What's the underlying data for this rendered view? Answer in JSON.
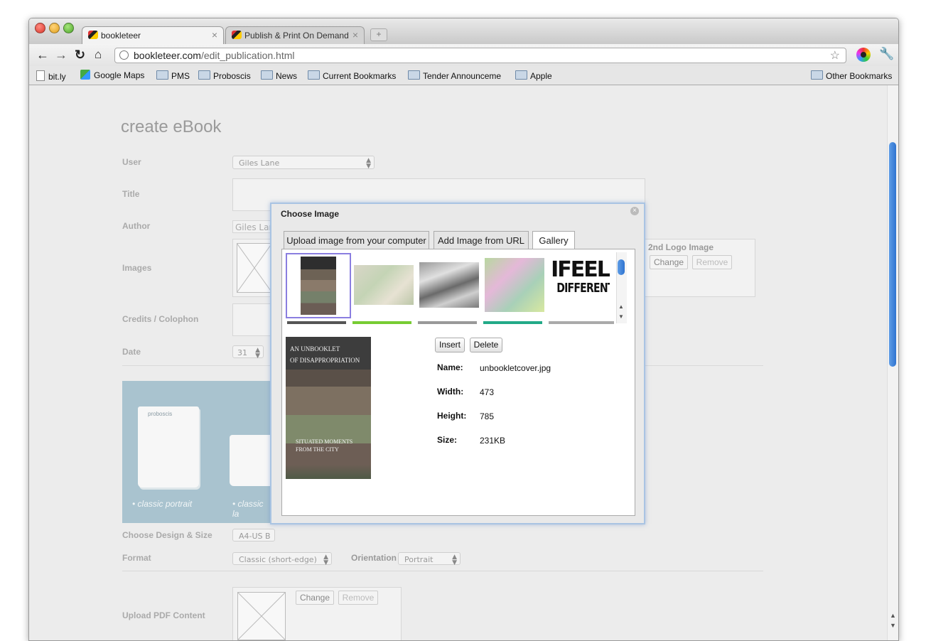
{
  "browser": {
    "tabs": [
      {
        "label": "bookleteer",
        "close": "×"
      },
      {
        "label": "Publish & Print On Demand",
        "close": "×"
      }
    ],
    "new_tab": "+",
    "url_host": "bookleteer.com",
    "url_path": "/edit_publication.html",
    "bookmarks": [
      "bit.ly",
      "Google Maps",
      "PMS",
      "Proboscis",
      "News",
      "Current Bookmarks",
      "Tender Announceme",
      "Apple"
    ],
    "other_bookmarks": "Other Bookmarks"
  },
  "form": {
    "heading": "create eBook",
    "user_label": "User",
    "user_value": "Giles Lane",
    "title_label": "Title",
    "author_label": "Author",
    "author_value": "Giles Lane",
    "images_label": "Images",
    "logo2_label": "2nd Logo Image",
    "change": "Change",
    "remove": "Remove",
    "credits_label": "Credits / Colophon",
    "date_label": "Date",
    "date_day": "31",
    "design_cards": [
      {
        "brand": "proboscis",
        "caption": "• classic portrait"
      },
      {
        "caption": "• classic la"
      }
    ],
    "design_label": "Choose Design & Size",
    "design_value": "A4-US B",
    "format_label": "Format",
    "format_value": "Classic (short-edge)",
    "orientation_label": "Orientation",
    "orientation_value": "Portrait",
    "pdf_label": "Upload PDF Content"
  },
  "modal": {
    "title": "Choose Image",
    "close": "×",
    "tabs": [
      "Upload image from your computer",
      "Add Image from URL",
      "Gallery"
    ],
    "gallery_text_thumb": [
      "IFEEL",
      "DIFFERENT"
    ],
    "insert": "Insert",
    "delete": "Delete",
    "preview_title": [
      "AN UNBOOKLET",
      "OF DISAPPROPRIATION"
    ],
    "preview_subtitle": [
      "SITUATED MOMENTS",
      "FROM THE CITY"
    ],
    "details": [
      {
        "label": "Name:",
        "value": "unbookletcover.jpg"
      },
      {
        "label": "Width:",
        "value": "473"
      },
      {
        "label": "Height:",
        "value": "785"
      },
      {
        "label": "Size:",
        "value": "231KB"
      }
    ]
  }
}
